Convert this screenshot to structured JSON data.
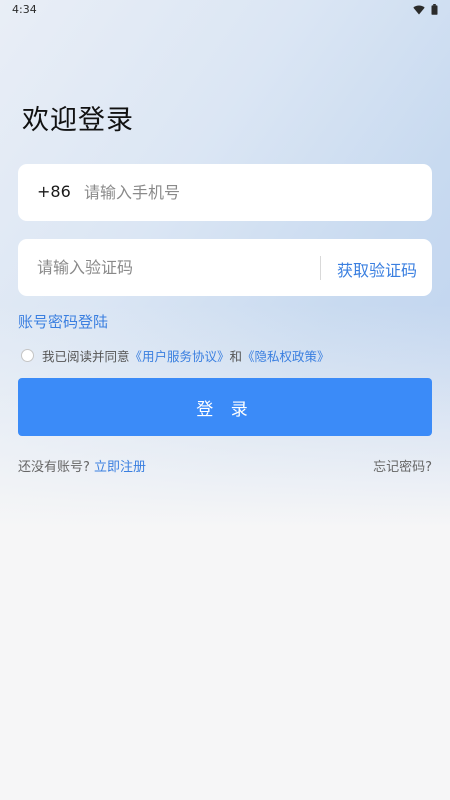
{
  "status_bar": {
    "time": "4:34",
    "icons": [
      "wifi-icon",
      "battery-icon"
    ]
  },
  "title": "欢迎登录",
  "phone": {
    "country_code": "+86",
    "placeholder": "请输入手机号",
    "value": ""
  },
  "code": {
    "placeholder": "请输入验证码",
    "value": "",
    "get_code_label": "获取验证码"
  },
  "password_login_label": "账号密码登陆",
  "agreement": {
    "checked": false,
    "prefix": "我已阅读并同意",
    "user_agreement": "《用户服务协议》",
    "conjunction": "和",
    "privacy_policy": "《隐私权政策》"
  },
  "login_button_label": "登 录",
  "register": {
    "prompt": "还没有账号?",
    "link": "立即注册"
  },
  "forgot_password_label": "忘记密码?",
  "colors": {
    "accent": "#3b8bf8",
    "link": "#3a7fe0"
  }
}
